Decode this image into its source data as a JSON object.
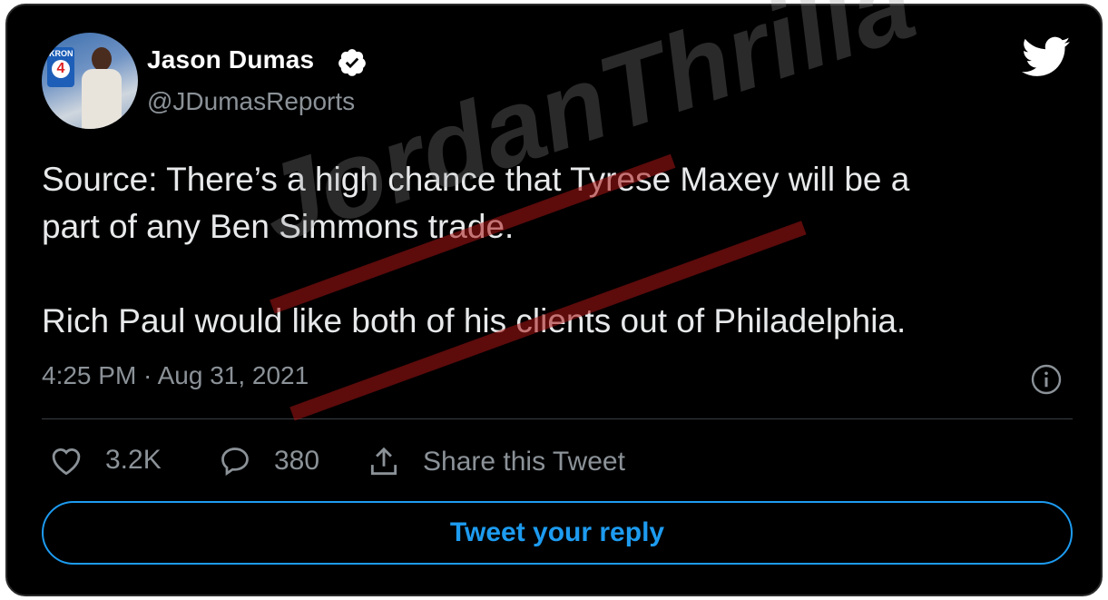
{
  "tweet": {
    "author_name": "Jason Dumas",
    "author_handle": "@JDumasReports",
    "verified": true,
    "avatar_logo_text": "KRON",
    "avatar_logo_number": "4",
    "text_paragraph_1_line_1": "Source: There’s a high chance that Tyrese Maxey will be a",
    "text_paragraph_1_line_2": "part of any Ben Simmons trade.",
    "text_paragraph_2": "Rich Paul would like both of his clients out of Philadelphia.",
    "timestamp": "4:25 PM · Aug 31, 2021"
  },
  "actions": {
    "like_count": "3.2K",
    "reply_count": "380",
    "share_label": "Share this Tweet"
  },
  "reply_button_label": "Tweet your reply",
  "watermark_text": "JordanThrilla",
  "icons": {
    "brand": "twitter-bird-icon",
    "verified": "verified-badge-icon",
    "info": "info-icon",
    "like": "heart-icon",
    "reply": "speech-bubble-icon",
    "share": "share-upload-icon"
  },
  "colors": {
    "background": "#000000",
    "text": "#e7e9ea",
    "secondary_text": "#8b9298",
    "accent": "#1d9bf0",
    "divider": "#3a3f44"
  }
}
